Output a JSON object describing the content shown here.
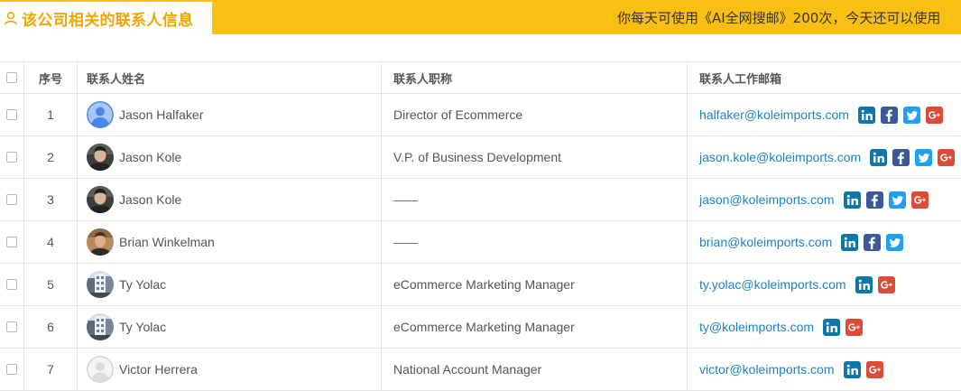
{
  "header": {
    "title": "该公司相关的联系人信息",
    "quota_text": "你每天可使用《AI全网搜邮》200次，今天还可以使用"
  },
  "table": {
    "columns": {
      "index": "序号",
      "name": "联系人姓名",
      "title": "联系人职称",
      "email": "联系人工作邮箱"
    },
    "rows": [
      {
        "index": "1",
        "name": "Jason Halfaker",
        "title": "Director of Ecommerce",
        "email": "halfaker@koleimports.com",
        "avatar": "default-person",
        "socials": [
          "linkedin",
          "facebook",
          "twitter",
          "google-plus"
        ]
      },
      {
        "index": "2",
        "name": "Jason Kole",
        "title": "V.P. of Business Development",
        "email": "jason.kole@koleimports.com",
        "avatar": "photo-dark",
        "socials": [
          "linkedin",
          "facebook",
          "twitter",
          "google-plus"
        ]
      },
      {
        "index": "3",
        "name": "Jason Kole",
        "title": "——",
        "email": "jason@koleimports.com",
        "avatar": "photo-dark",
        "socials": [
          "linkedin",
          "facebook",
          "twitter",
          "google-plus"
        ]
      },
      {
        "index": "4",
        "name": "Brian Winkelman",
        "title": "——",
        "email": "brian@koleimports.com",
        "avatar": "photo-warm",
        "socials": [
          "linkedin",
          "facebook",
          "twitter"
        ]
      },
      {
        "index": "5",
        "name": "Ty Yolac",
        "title": "eCommerce Marketing Manager",
        "email": "ty.yolac@koleimports.com",
        "avatar": "photo-building",
        "socials": [
          "linkedin",
          "google-plus"
        ]
      },
      {
        "index": "6",
        "name": "Ty Yolac",
        "title": "eCommerce Marketing Manager",
        "email": "ty@koleimports.com",
        "avatar": "photo-building",
        "socials": [
          "linkedin",
          "google-plus"
        ]
      },
      {
        "index": "7",
        "name": "Victor Herrera",
        "title": "National Account Manager",
        "email": "victor@koleimports.com",
        "avatar": "default-gray",
        "socials": [
          "linkedin",
          "google-plus"
        ]
      }
    ]
  },
  "colors": {
    "accent": "#f9bf12",
    "title": "#f0a500",
    "link": "#1f82c0",
    "linkedin": "#0e76a8",
    "facebook": "#3b5998",
    "twitter": "#1da1f2",
    "google_plus": "#dd4b39"
  }
}
